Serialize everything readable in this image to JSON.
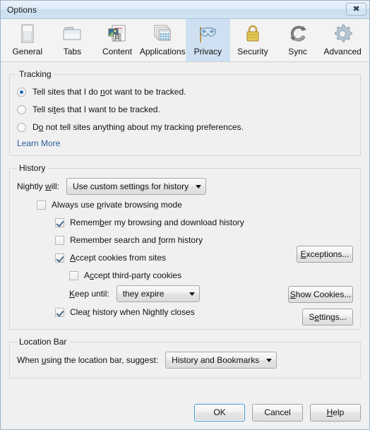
{
  "window": {
    "title": "Options",
    "close_icon": "close-icon",
    "close_glyph": "✖"
  },
  "tabs": [
    {
      "label": "General",
      "icon": "window-icon",
      "selected": false
    },
    {
      "label": "Tabs",
      "icon": "folder-tabs-icon",
      "selected": false
    },
    {
      "label": "Content",
      "icon": "content-page-icon",
      "selected": false
    },
    {
      "label": "Applications",
      "icon": "applications-icon",
      "selected": false
    },
    {
      "label": "Privacy",
      "icon": "mask-icon",
      "selected": true
    },
    {
      "label": "Security",
      "icon": "padlock-icon",
      "selected": false
    },
    {
      "label": "Sync",
      "icon": "sync-arrows-icon",
      "selected": false
    },
    {
      "label": "Advanced",
      "icon": "gear-icon",
      "selected": false
    }
  ],
  "tracking": {
    "legend": "Tracking",
    "options": [
      {
        "label_pre": "Tell sites that I do ",
        "mnemonic": "n",
        "label_post": "ot want to be tracked.",
        "checked": true
      },
      {
        "label_pre": "Tell si",
        "mnemonic": "t",
        "label_post": "es that I want to be tracked.",
        "checked": false
      },
      {
        "label_pre": "D",
        "mnemonic": "o",
        "label_post": " not tell sites anything about my tracking preferences.",
        "checked": false
      }
    ],
    "learn_more": "Learn More"
  },
  "history": {
    "legend": "History",
    "will_label_pre": "Nightly ",
    "will_label_mnemonic": "w",
    "will_label_post": "ill:",
    "will_value": "Use custom settings for history",
    "checkboxes": [
      {
        "pre": "Always use ",
        "mnemonic": "p",
        "post": "rivate browsing mode",
        "checked": false
      },
      {
        "pre": "Remem",
        "mnemonic": "b",
        "post": "er my browsing and download history",
        "checked": true
      },
      {
        "pre": "Remember search and ",
        "mnemonic": "f",
        "post": "orm history",
        "checked": false
      },
      {
        "pre": "",
        "mnemonic": "A",
        "post": "ccept cookies from sites",
        "checked": true
      },
      {
        "pre": "A",
        "mnemonic": "c",
        "post": "cept third-party cookies",
        "checked": false
      },
      {
        "pre": "Clea",
        "mnemonic": "r",
        "post": " history when Nightly closes",
        "checked": true
      }
    ],
    "keep_until_label_pre": "",
    "keep_until_label_mnemonic": "K",
    "keep_until_label_post": "eep until:",
    "keep_until_value": "they expire",
    "exceptions_pre": "",
    "exceptions_mnemonic": "E",
    "exceptions_post": "xceptions...",
    "show_cookies_pre": "",
    "show_cookies_mnemonic": "S",
    "show_cookies_post": "how Cookies...",
    "settings_pre": "S",
    "settings_mnemonic": "e",
    "settings_post": "ttings..."
  },
  "location_bar": {
    "legend": "Location Bar",
    "label_pre": "When ",
    "label_mnemonic": "u",
    "label_post": "sing the location bar, suggest:",
    "value": "History and Bookmarks"
  },
  "footer": {
    "ok": "OK",
    "cancel": "Cancel",
    "help_pre": "",
    "help_mnemonic": "H",
    "help_post": "elp"
  },
  "colors": {
    "accent": "#1c6fb5",
    "tab_selected_bg": "#cfe0f2",
    "link": "#2b5f9e",
    "dialog_bg": "#f0f0f0",
    "default_button_border": "#3c9cc8"
  }
}
